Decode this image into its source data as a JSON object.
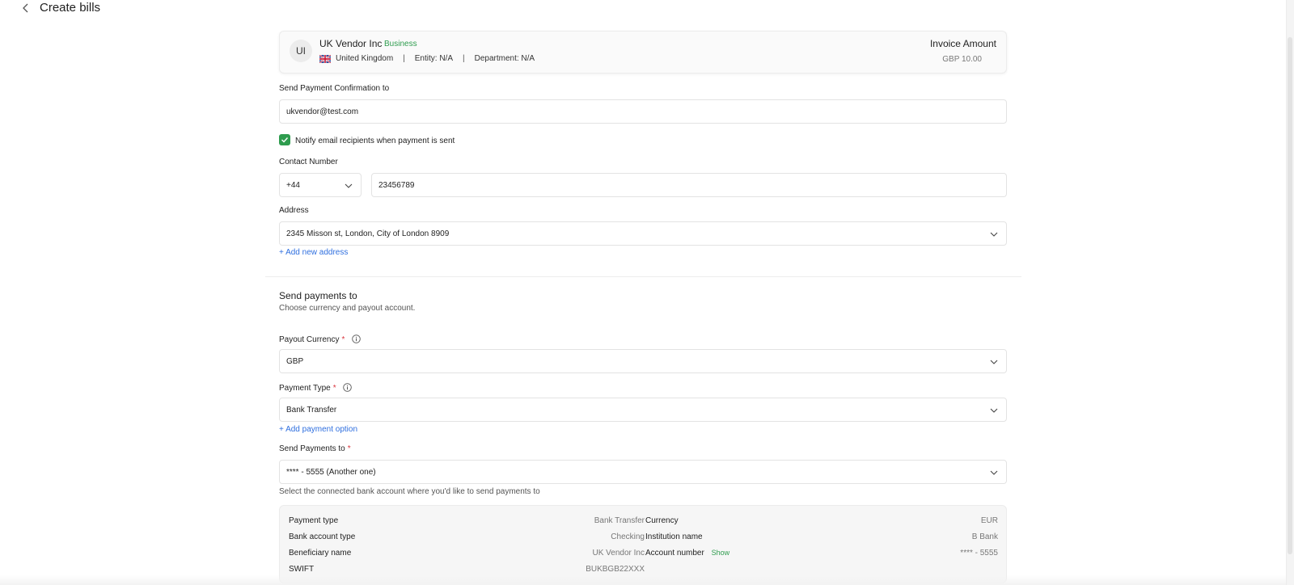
{
  "header": {
    "title": "Create bills"
  },
  "vendor": {
    "initials": "UI",
    "name": "UK Vendor Inc",
    "type": "Business",
    "country": "United Kingdom",
    "entity": "Entity: N/A",
    "department": "Department: N/A",
    "separator": "|",
    "invoice_label": "Invoice Amount",
    "invoice_amount": "GBP 10.00"
  },
  "confirmation": {
    "label": "Send Payment Confirmation to",
    "email": "ukvendor@test.com"
  },
  "notify": {
    "label": "Notify email recipients when payment is sent",
    "checked": true
  },
  "contact": {
    "label": "Contact Number",
    "code": "+44",
    "number": "23456789"
  },
  "address": {
    "label": "Address",
    "value": "2345 Misson st, London, City of London 8909",
    "add_link": "+ Add new address"
  },
  "payments": {
    "title": "Send payments to",
    "subtitle": "Choose currency and payout account.",
    "currency_label": "Payout Currency",
    "currency_value": "GBP",
    "type_label": "Payment Type",
    "type_value": "Bank Transfer",
    "add_option": "+ Add payment option",
    "send_to_label": "Send Payments to",
    "send_to_value": "**** - 5555 (Another one)",
    "helper": "Select the connected bank account where you'd like to send payments to",
    "required_mark": "*"
  },
  "details": {
    "left": [
      {
        "label": "Payment type",
        "value": "Bank Transfer"
      },
      {
        "label": "Bank account type",
        "value": "Checking"
      },
      {
        "label": "Beneficiary name",
        "value": "UK Vendor Inc"
      },
      {
        "label": "SWIFT",
        "value": "BUKBGB22XXX"
      }
    ],
    "right": [
      {
        "label": "Currency",
        "value": "EUR"
      },
      {
        "label": "Institution name",
        "value": "B Bank"
      },
      {
        "label": "Account number",
        "value": "**** - 5555",
        "show": "Show"
      }
    ]
  },
  "colors": {
    "accent_green": "#2e9c4e",
    "link_blue": "#2f6fdf",
    "required_red": "#d9363e"
  }
}
